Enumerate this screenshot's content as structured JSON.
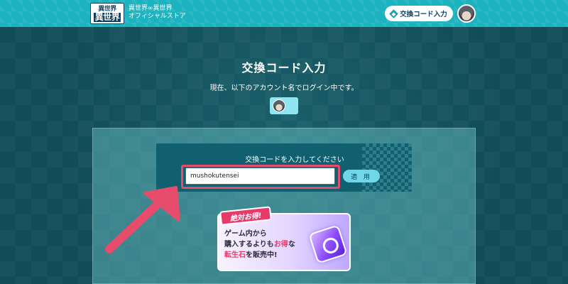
{
  "header": {
    "logo_line1": "異世界",
    "logo_line2": "異世界",
    "store_line1": "異世界∞異世界",
    "store_line2": "オフィシャルストア",
    "code_button_label": "交換コード入力",
    "accent_color": "#1ab3bf"
  },
  "main": {
    "title": "交換コード入力",
    "subtitle": "現在、以下のアカウント名でログイン中です。",
    "card_label": "交換コードを入力してください",
    "code_input_value": "mushokutensei",
    "apply_button_label": "適 用"
  },
  "banner": {
    "badge": "絶対お得!",
    "line1": "ゲーム内から",
    "line2_a": "購入するよりも",
    "line2_b": "お得",
    "line2_c": "な",
    "line3_a": "転生石",
    "line3_b": "を販売中!",
    "highlight_color": "#e63a6b"
  },
  "annotation": {
    "arrow_color": "#e84c6c"
  }
}
